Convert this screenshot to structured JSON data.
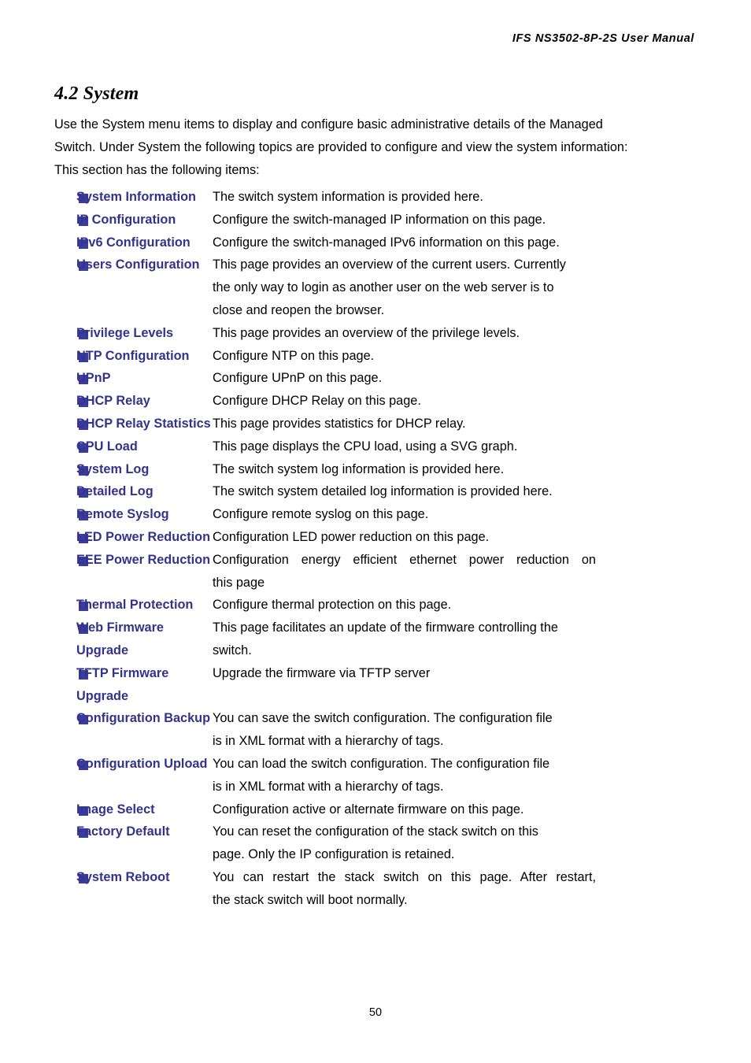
{
  "header": {
    "running_title": "IFS  NS3502-8P-2S  User  Manual"
  },
  "section": {
    "title": "4.2 System",
    "intro_lines": [
      "Use the System menu items to display and configure basic administrative details of the Managed",
      "Switch. Under System the following topics are provided to configure and view the system information:",
      "This section has the following items:"
    ]
  },
  "colors": {
    "bullet": "#3b3b9e",
    "term_text": "#33338c",
    "body_text": "#000000",
    "page_background": "#ffffff"
  },
  "items": [
    {
      "term": "System Information",
      "desc_lines": [
        "The switch system information is provided here."
      ],
      "justified": false
    },
    {
      "term": "IP Configuration",
      "desc_lines": [
        "Configure the switch-managed IP information on this page."
      ],
      "justified": false
    },
    {
      "term": "IPv6 Configuration",
      "desc_lines": [
        "Configure the switch-managed IPv6 information on this page."
      ],
      "justified": false
    },
    {
      "term": "Users Configuration",
      "desc_lines": [
        "This page provides an overview of the current users. Currently",
        "the only way to login as another user on the web server is to",
        "close and reopen the browser."
      ],
      "justified": false
    },
    {
      "term": "Privilege Levels",
      "desc_lines": [
        "This page provides an overview of the privilege levels."
      ],
      "justified": false
    },
    {
      "term": "NTP Configuration",
      "desc_lines": [
        "Configure NTP on this page."
      ],
      "justified": false
    },
    {
      "term": "UPnP",
      "desc_lines": [
        "Configure UPnP on this page."
      ],
      "justified": false
    },
    {
      "term": "DHCP Relay",
      "desc_lines": [
        "Configure DHCP Relay on this page."
      ],
      "justified": false
    },
    {
      "term": "DHCP Relay Statistics",
      "desc_lines": [
        "This page provides statistics for DHCP relay."
      ],
      "justified": false
    },
    {
      "term": "CPU Load",
      "desc_lines": [
        "This page displays the CPU load, using a SVG graph."
      ],
      "justified": false
    },
    {
      "term": "System Log",
      "desc_lines": [
        "The switch system log information is provided here."
      ],
      "justified": false
    },
    {
      "term": "Detailed Log",
      "desc_lines": [
        "The switch system detailed log information is provided here."
      ],
      "justified": false
    },
    {
      "term": "Remote Syslog",
      "desc_lines": [
        "Configure remote syslog on this page."
      ],
      "justified": false
    },
    {
      "term": "LED Power Reduction",
      "desc_lines": [
        "Configuration LED power reduction on this page."
      ],
      "justified": false
    },
    {
      "term": "EEE Power Reduction",
      "desc_lines": [
        "Configuration energy efficient ethernet power reduction on",
        "this page"
      ],
      "justified": true
    },
    {
      "term": "Thermal Protection",
      "desc_lines": [
        "Configure thermal protection on this page."
      ],
      "justified": false
    },
    {
      "term": "Web Firmware\nUpgrade",
      "desc_lines": [
        "This page facilitates an update of the firmware controlling the",
        "switch."
      ],
      "justified": false
    },
    {
      "term": "TFTP Firmware\nUpgrade",
      "desc_lines": [
        "Upgrade the firmware via TFTP server"
      ],
      "justified": false
    },
    {
      "term": "Configuration Backup",
      "desc_lines": [
        "You can save the switch configuration. The configuration file",
        "is in XML format with a hierarchy of tags."
      ],
      "justified": false
    },
    {
      "term": "Configuration Upload",
      "desc_lines": [
        "You can load the switch configuration. The configuration file",
        "is in XML format with a hierarchy of tags."
      ],
      "justified": false
    },
    {
      "term": "Image Select",
      "desc_lines": [
        "Configuration active or alternate firmware on this page."
      ],
      "justified": false
    },
    {
      "term": "Factory Default",
      "desc_lines": [
        "You can reset the configuration of the stack switch on this",
        "page. Only the IP configuration is retained."
      ],
      "justified": false
    },
    {
      "term": "System Reboot",
      "desc_lines": [
        "You can restart the stack switch on this page. After restart,",
        "the stack switch will boot normally."
      ],
      "justified": true
    }
  ],
  "footer": {
    "page_number": "50"
  }
}
